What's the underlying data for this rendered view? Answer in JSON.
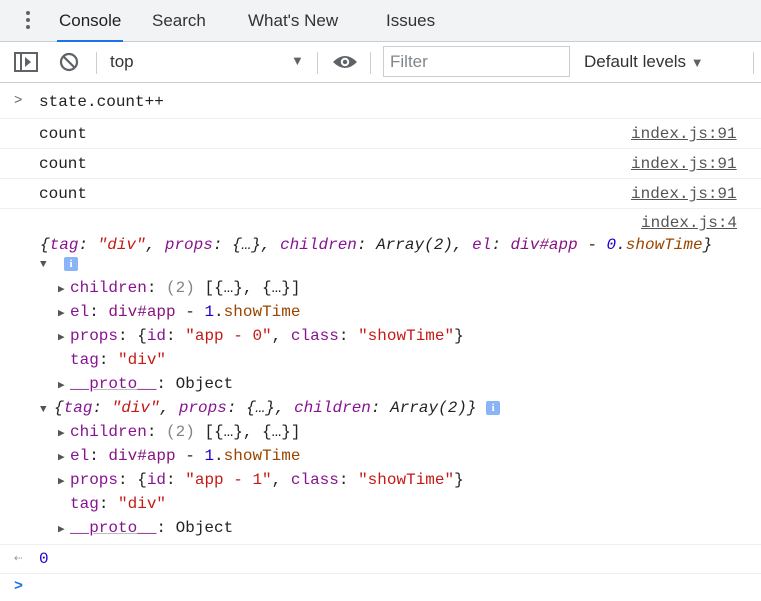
{
  "tabs": [
    "Console",
    "Search",
    "What's New",
    "Issues"
  ],
  "toolbar": {
    "context": "top",
    "filter_placeholder": "Filter",
    "levels": "Default levels"
  },
  "input_command": "state.count++",
  "logs": [
    {
      "text": "count",
      "source": "index.js:91"
    },
    {
      "text": "count",
      "source": "index.js:91"
    },
    {
      "text": "count",
      "source": "index.js:91"
    }
  ],
  "object_source": "index.js:4",
  "obj1": {
    "summary": {
      "tag": "\"div\"",
      "el": "div#app",
      "el_index": "0",
      "el_class": "showTime"
    },
    "children": "[{…}, {…}]",
    "el": {
      "tagname": "div#app",
      "index": "1",
      "cls": "showTime"
    },
    "props": {
      "id": "\"app - 0\"",
      "class": "\"showTime\""
    },
    "tag": "\"div\"",
    "proto": "Object"
  },
  "obj2": {
    "summary": {
      "tag": "\"div\""
    },
    "children": "[{…}, {…}]",
    "el": {
      "tagname": "div#app",
      "index": "1",
      "cls": "showTime"
    },
    "props": {
      "id": "\"app - 1\"",
      "class": "\"showTime\""
    },
    "tag": "\"div\"",
    "proto": "Object"
  },
  "result": "0"
}
